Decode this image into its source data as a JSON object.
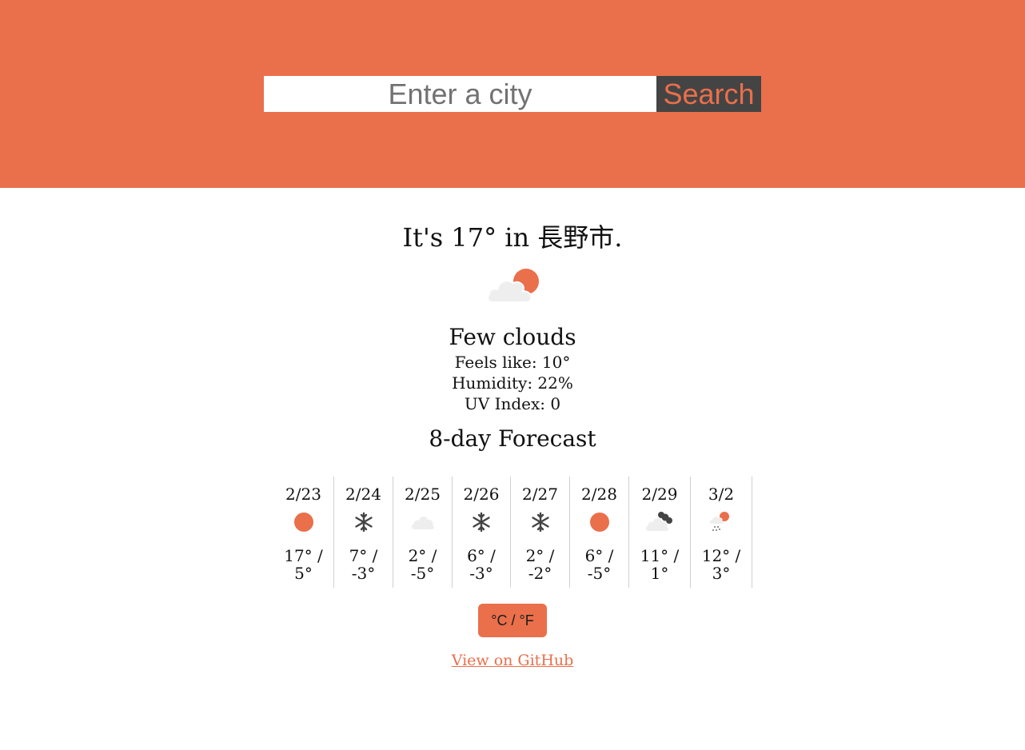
{
  "search": {
    "placeholder": "Enter a city",
    "value": "",
    "button_label": "Search"
  },
  "current": {
    "headline": "It's 17° in 長野市.",
    "icon": "few-clouds-day-icon",
    "condition": "Few clouds",
    "feels_like": "Feels like: 10°",
    "humidity": "Humidity: 22%",
    "uv_index": "UV Index: 0"
  },
  "forecast": {
    "title": "8-day Forecast",
    "days": [
      {
        "date": "2/23",
        "icon": "sun-icon",
        "high": "17° /",
        "low": "5°"
      },
      {
        "date": "2/24",
        "icon": "snow-icon",
        "high": "7° /",
        "low": "-3°"
      },
      {
        "date": "2/25",
        "icon": "cloud-icon",
        "high": "2° /",
        "low": "-5°"
      },
      {
        "date": "2/26",
        "icon": "snow-icon",
        "high": "6° /",
        "low": "-3°"
      },
      {
        "date": "2/27",
        "icon": "snow-icon",
        "high": "2° /",
        "low": "-2°"
      },
      {
        "date": "2/28",
        "icon": "sun-icon",
        "high": "6° /",
        "low": "-5°"
      },
      {
        "date": "2/29",
        "icon": "broken-clouds-icon",
        "high": "11° /",
        "low": "1°"
      },
      {
        "date": "3/2",
        "icon": "rain-sun-icon",
        "high": "12° /",
        "low": "3°"
      }
    ]
  },
  "unit_toggle_label": "°C / °F",
  "github_link": "View on GitHub",
  "colors": {
    "accent": "#ea6f4b",
    "dark": "#444444",
    "cloud": "#eeeeee"
  }
}
